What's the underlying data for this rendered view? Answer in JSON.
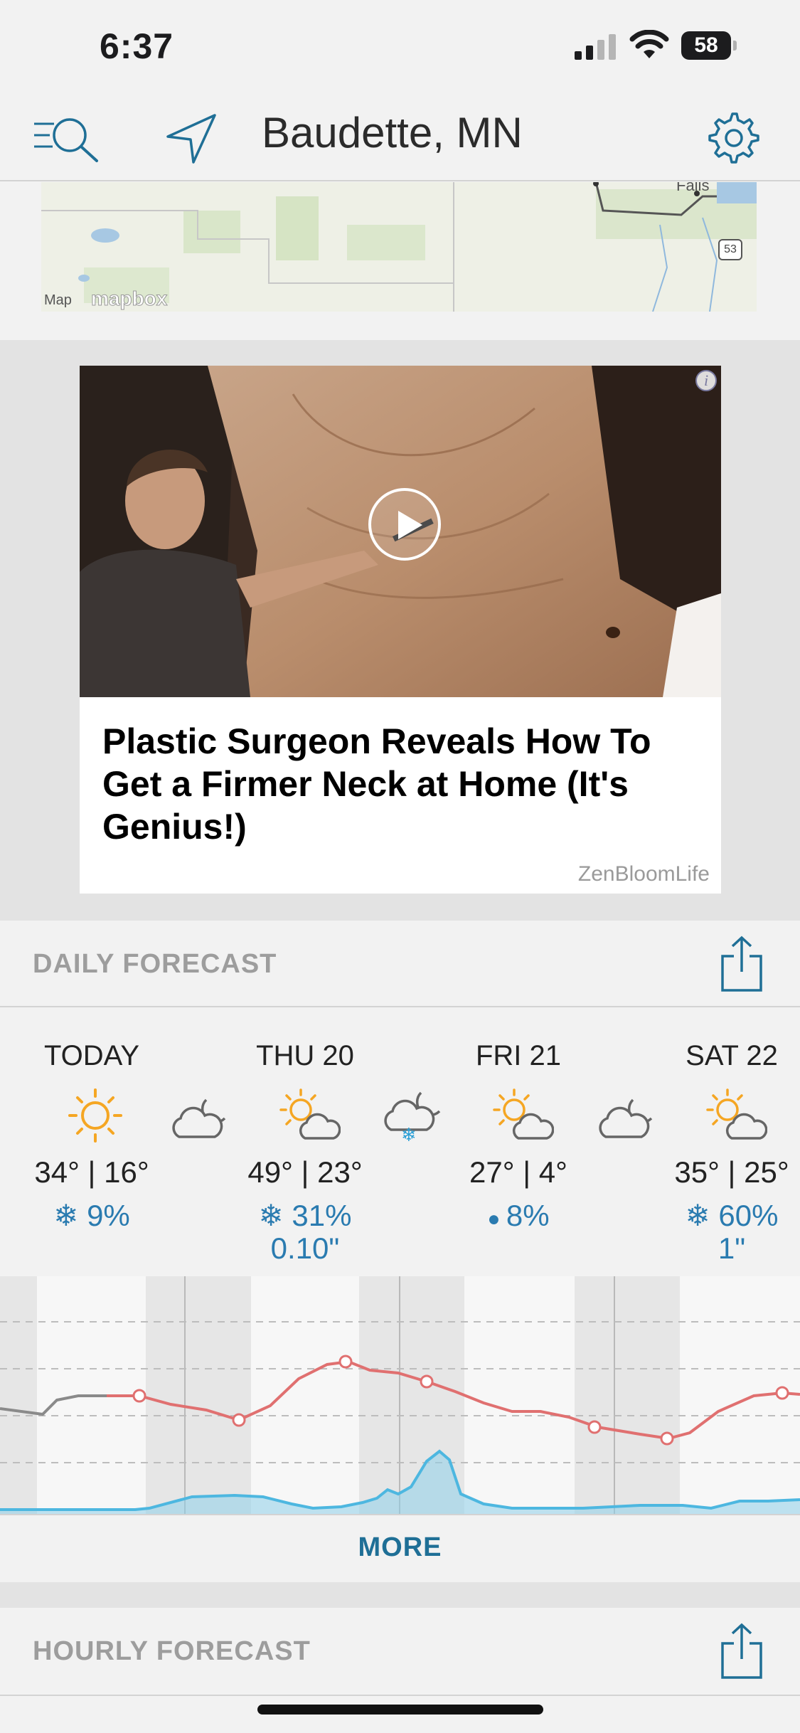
{
  "status_bar": {
    "time": "6:37",
    "battery": "58"
  },
  "nav": {
    "location": "Baudette, MN",
    "icons": [
      "menu-search-icon",
      "location-arrow-icon",
      "gear-icon"
    ]
  },
  "map": {
    "credit": "Map",
    "logo": "mapbox",
    "labels": [
      "Falls",
      "53"
    ]
  },
  "ad": {
    "headline": "Plastic Surgeon Reveals How To Get a Firmer Neck at Home (It's Genius!)",
    "source": "ZenBloomLife",
    "info_label": "i"
  },
  "daily_forecast": {
    "title": "DAILY FORECAST",
    "days": [
      {
        "name": "TODAY",
        "temps": "34° | 16°",
        "precip": "9%",
        "precip_amount": "",
        "precip_type": "snow",
        "day_icon": "sun-icon"
      },
      {
        "name": "THU 20",
        "temps": "49° | 23°",
        "precip": "31%",
        "precip_amount": "0.10\"",
        "precip_type": "snow",
        "day_icon": "partly-cloudy-icon"
      },
      {
        "name": "FRI 21",
        "temps": "27° | 4°",
        "precip": "8%",
        "precip_amount": "",
        "precip_type": "rain",
        "day_icon": "partly-cloudy-icon"
      },
      {
        "name": "SAT 22",
        "temps": "35° | 25°",
        "precip": "60%",
        "precip_amount": "1\"",
        "precip_type": "snow",
        "day_icon": "partly-cloudy-icon"
      }
    ],
    "night_icons": [
      "cloudy-night-icon",
      "snowy-night-icon",
      "cloudy-night-icon"
    ],
    "more_label": "MORE"
  },
  "hourly_forecast": {
    "title": "HOURLY FORECAST"
  },
  "colors": {
    "accent": "#1f6f96",
    "temp_line": "#e07070",
    "precip_fill": "#8ed0ea",
    "precip_text": "#2a7bb0",
    "section_label": "#9d9d9d"
  }
}
